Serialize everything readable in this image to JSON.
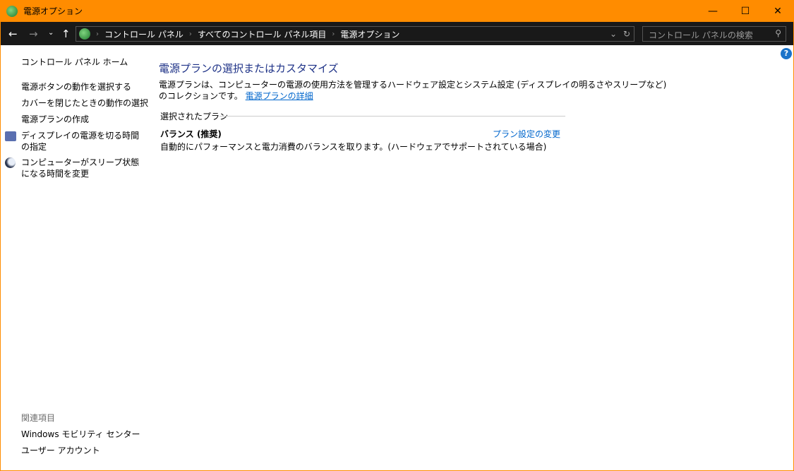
{
  "window": {
    "title": "電源オプション",
    "minimize": "—",
    "maximize": "☐",
    "close": "✕"
  },
  "address": {
    "crumbs": [
      "コントロール パネル",
      "すべてのコントロール パネル項目",
      "電源オプション"
    ],
    "search_placeholder": "コントロール パネルの検索"
  },
  "sidebar": {
    "home": "コントロール パネル ホーム",
    "items": [
      "電源ボタンの動作を選択する",
      "カバーを閉じたときの動作の選択",
      "電源プランの作成",
      "ディスプレイの電源を切る時間の指定",
      "コンピューターがスリープ状態になる時間を変更"
    ],
    "related_heading": "関連項目",
    "related": [
      "Windows モビリティ センター",
      "ユーザー アカウント"
    ]
  },
  "main": {
    "title": "電源プランの選択またはカスタマイズ",
    "description": "電源プランは、コンピューターの電源の使用方法を管理するハードウェア設定とシステム設定 (ディスプレイの明るさやスリープなど)",
    "description2": "のコレクションです。",
    "details_link": "電源プランの詳細",
    "section": "選択されたプラン",
    "plan_name": "バランス (推奨)",
    "plan_desc": "自動的にパフォーマンスと電力消費のバランスを取ります。(ハードウェアでサポートされている場合)",
    "plan_link": "プラン設定の変更"
  },
  "help": "?"
}
